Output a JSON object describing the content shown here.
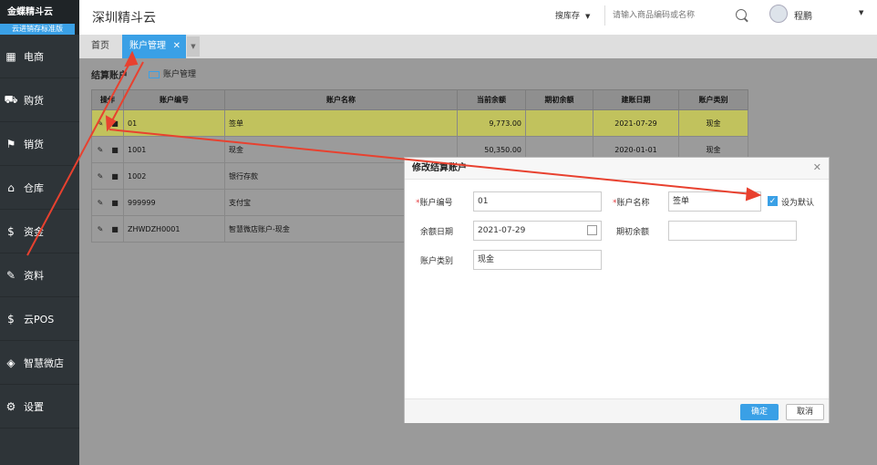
{
  "logo": {
    "brand": "金蝶精斗云",
    "subtitle": "云进销存标准版"
  },
  "sidebar": {
    "items": [
      {
        "label": "电商",
        "icon": "store-icon"
      },
      {
        "label": "购货",
        "icon": "cart-icon"
      },
      {
        "label": "销货",
        "icon": "sale-icon"
      },
      {
        "label": "仓库",
        "icon": "warehouse-icon"
      },
      {
        "label": "资金",
        "icon": "money-icon"
      },
      {
        "label": "资料",
        "icon": "pencil-icon"
      },
      {
        "label": "云POS",
        "icon": "pos-icon"
      },
      {
        "label": "智慧微店",
        "icon": "shop-icon"
      },
      {
        "label": "设置",
        "icon": "gear-icon"
      }
    ]
  },
  "header": {
    "company": "深圳精斗云",
    "search_type": "搜库存",
    "search_placeholder": "请输入商品编码或名称",
    "user": "程鹏"
  },
  "tabs": {
    "home": "首页",
    "active": "账户管理"
  },
  "content": {
    "breadcrumb": "结算账户",
    "crumb2": "账户管理",
    "table": {
      "headers": [
        "操作",
        "账户编号",
        "账户名称",
        "当前余额",
        "期初余额",
        "建账日期",
        "账户类别"
      ],
      "rows": [
        {
          "code": "01",
          "name": "签单",
          "balance": "9,773.00",
          "opening": "",
          "date": "2021-07-29",
          "type": "现金"
        },
        {
          "code": "1001",
          "name": "现金",
          "balance": "50,350.00",
          "opening": "",
          "date": "2020-01-01",
          "type": "现金"
        },
        {
          "code": "1002",
          "name": "银行存款",
          "balance": "",
          "opening": "",
          "date": "",
          "type": ""
        },
        {
          "code": "999999",
          "name": "支付宝",
          "balance": "",
          "opening": "",
          "date": "",
          "type": ""
        },
        {
          "code": "ZHWDZH0001",
          "name": "智慧微店账户-现金",
          "balance": "",
          "opening": "",
          "date": "",
          "type": ""
        }
      ]
    }
  },
  "modal": {
    "title": "修改结算账户",
    "code_label": "账户编号",
    "code_value": "01",
    "name_label": "账户名称",
    "name_value": "签单",
    "default_label": "设为默认",
    "date_label": "余额日期",
    "date_value": "2021-07-29",
    "opening_label": "期初余额",
    "opening_value": "",
    "type_label": "账户类别",
    "type_value": "现金",
    "ok": "确定",
    "cancel": "取消"
  }
}
